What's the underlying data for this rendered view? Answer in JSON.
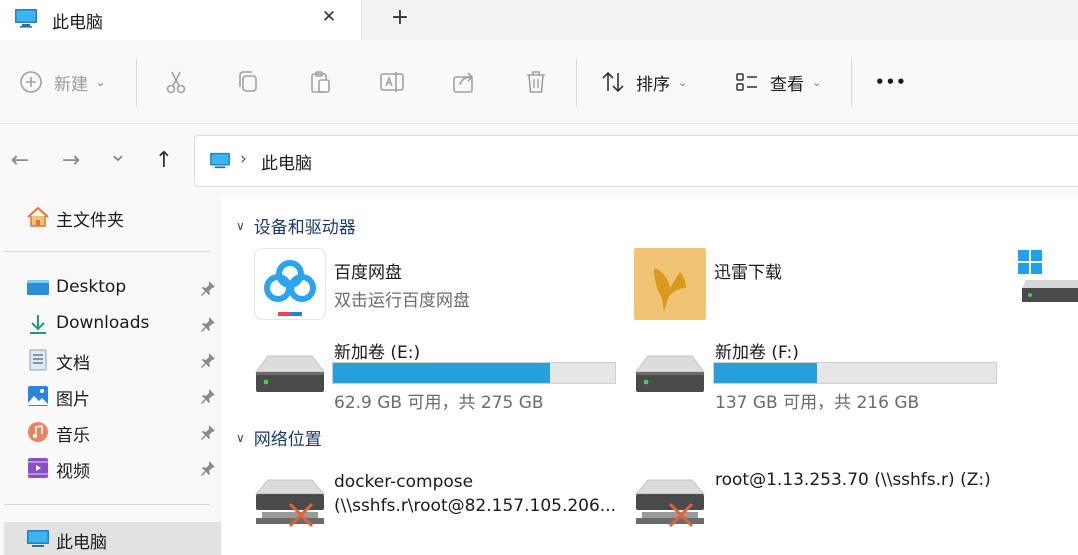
{
  "tab": {
    "title": "此电脑",
    "close_glyph": "✕",
    "new_glyph": "+"
  },
  "toolbar": {
    "new_label": "新建",
    "sort_label": "排序",
    "view_label": "查看",
    "more_label": "•••",
    "icons": [
      "cut-icon",
      "copy-icon",
      "paste-icon",
      "rename-icon",
      "share-icon",
      "delete-icon"
    ]
  },
  "nav": {
    "back": "←",
    "forward": "→",
    "recent": "⌄",
    "up": "↑"
  },
  "address": {
    "separator": "›",
    "path": "此电脑"
  },
  "sidebar": {
    "home": "主文件夹",
    "quick_access": [
      "Desktop",
      "Downloads",
      "文档",
      "图片",
      "音乐",
      "视频"
    ],
    "this_pc": "此电脑"
  },
  "main": {
    "devices_header": "设备和驱动器",
    "apps": [
      {
        "title": "百度网盘",
        "subtitle": "双击运行百度网盘"
      },
      {
        "title": "迅雷下载"
      }
    ],
    "drives": [
      {
        "title": "新加卷 (E:)",
        "usage": "62.9 GB 可用，共 275 GB",
        "fill_fraction": 0.771
      },
      {
        "title": "新加卷 (F:)",
        "usage": "137 GB 可用，共 216 GB",
        "fill_fraction": 0.366
      }
    ],
    "network_header": "网络位置",
    "network": [
      {
        "line1": "docker-compose",
        "line2": "(\\\\sshfs.r\\root@82.157.105.206..."
      },
      {
        "line1": "root@1.13.253.70 (\\\\sshfs.r) (Z:)"
      }
    ]
  },
  "colors": {
    "accent": "#26a0da",
    "group_header": "#1b3a6b",
    "pin": "#8a8a8a"
  }
}
